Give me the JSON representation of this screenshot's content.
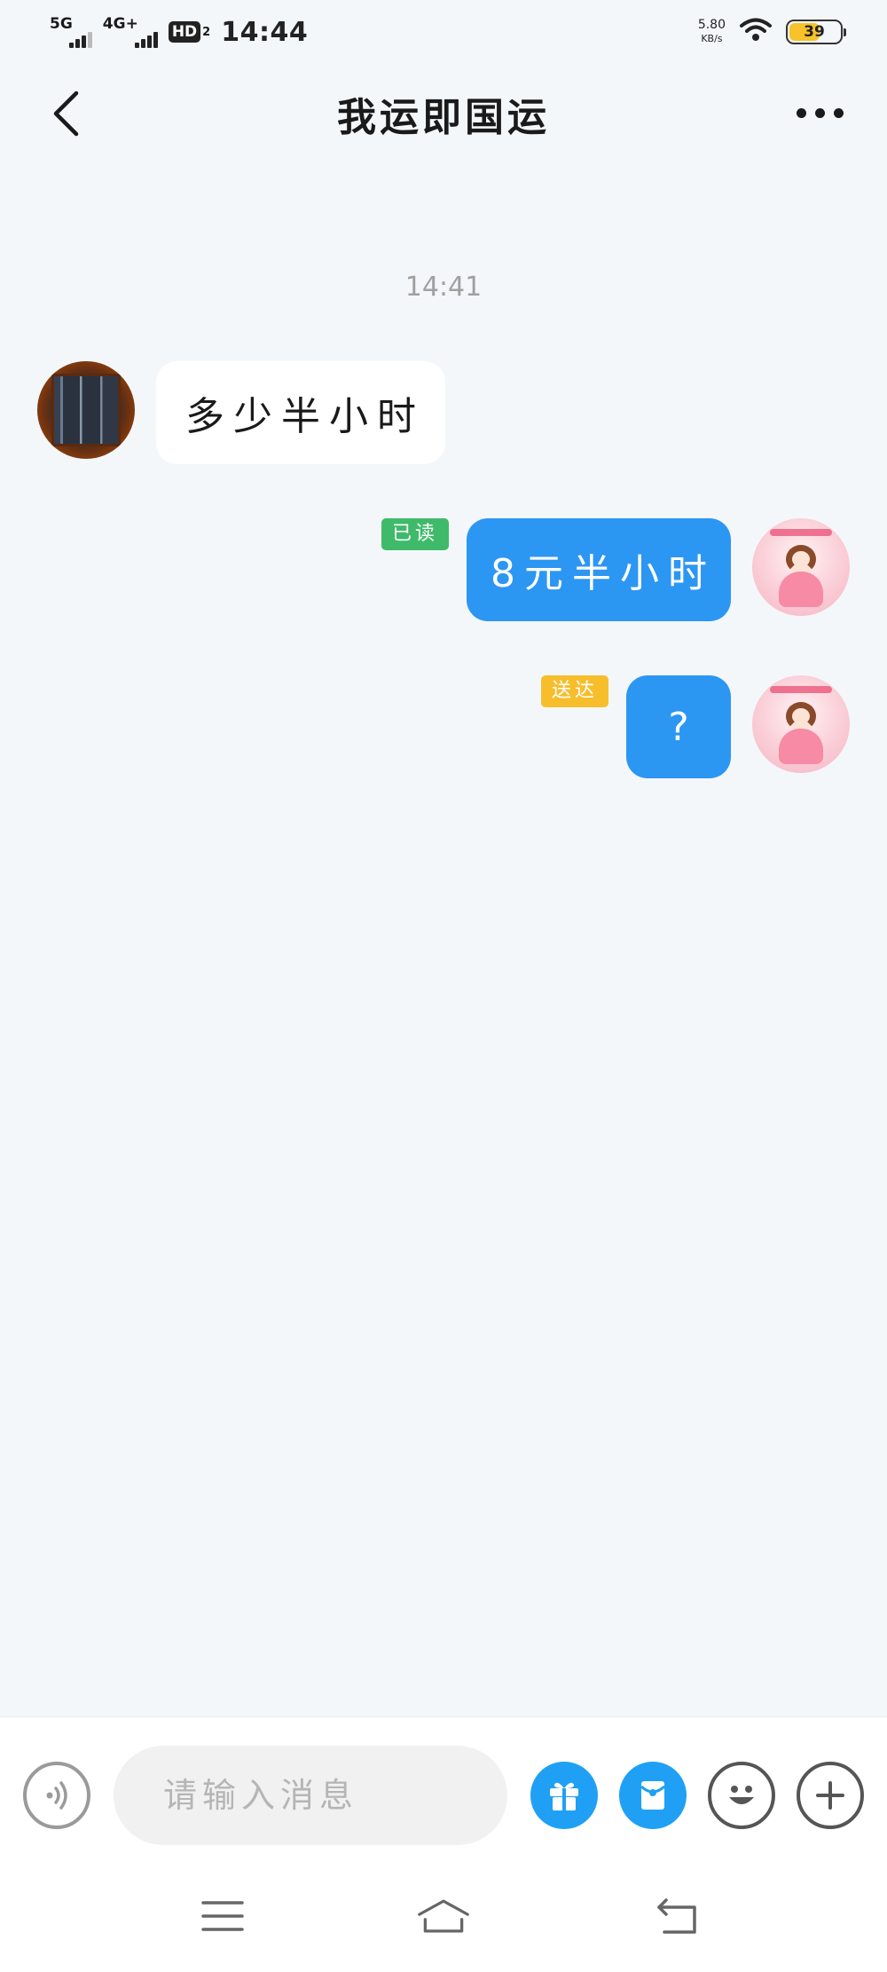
{
  "status_bar": {
    "network_1": "5G",
    "network_2": "4G+",
    "hd_label": "HD",
    "hd_sub": "2",
    "time": "14:44",
    "speed_value": "5.80",
    "speed_unit": "KB/s",
    "battery_level": "39"
  },
  "header": {
    "title": "我运即国运"
  },
  "chat": {
    "time_separator": "14:41",
    "messages": [
      {
        "from": "other",
        "text": "多少半小时"
      },
      {
        "from": "me",
        "text": "8元半小时",
        "receipt": "已读"
      },
      {
        "from": "me",
        "text": "?",
        "receipt": "送达"
      }
    ]
  },
  "input_bar": {
    "placeholder": "请输入消息",
    "accent_color": "#1fa0f4"
  },
  "colors": {
    "outgoing_bubble": "#2c96f3",
    "read_badge": "#3fba6a",
    "delivered_badge": "#f7be2c"
  }
}
